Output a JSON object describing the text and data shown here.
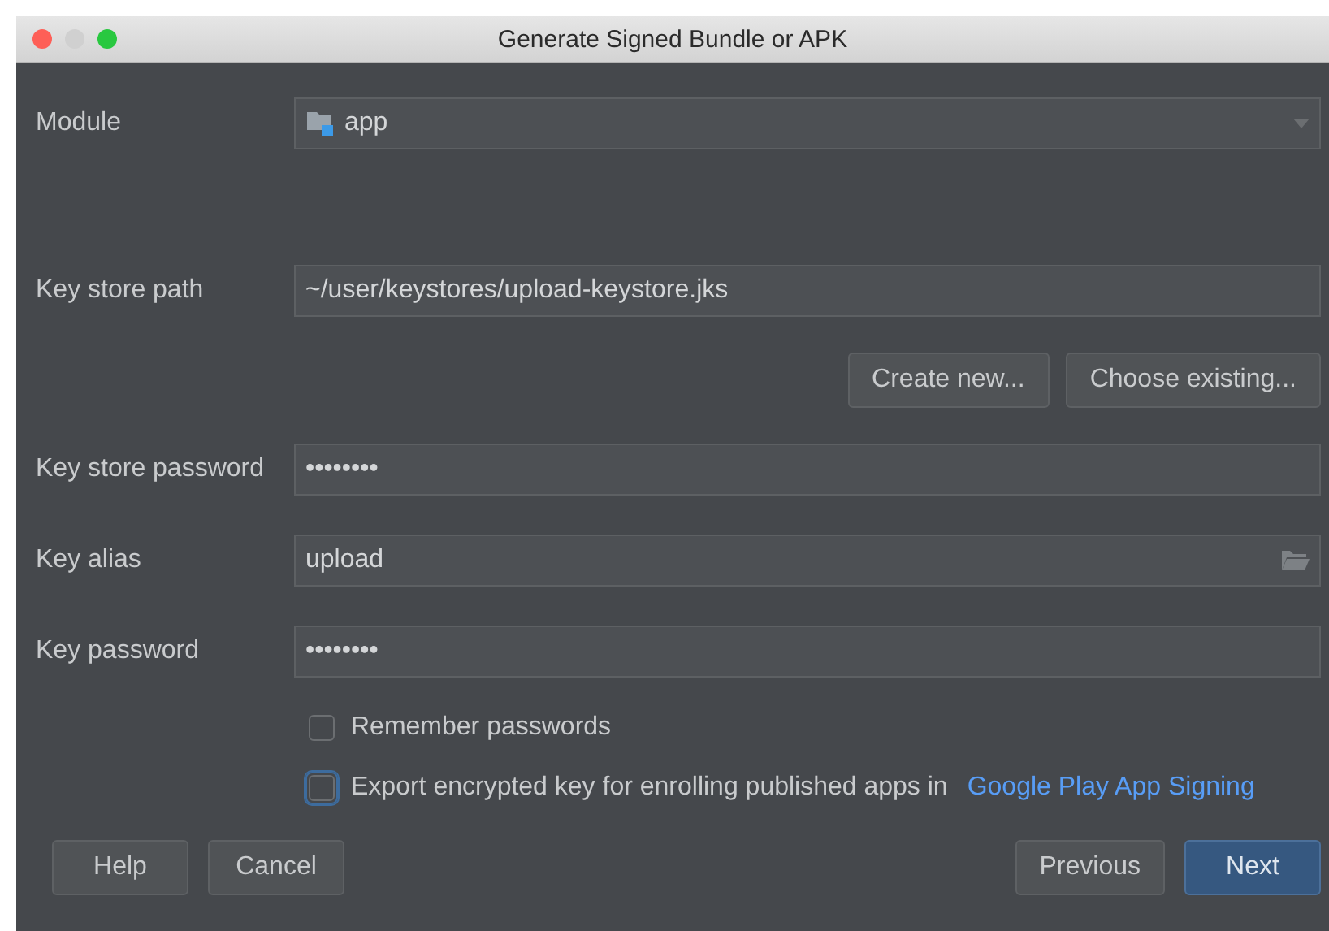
{
  "window": {
    "title": "Generate Signed Bundle or APK"
  },
  "module": {
    "label": "Module",
    "value": "app"
  },
  "key_store_path": {
    "label": "Key store path",
    "value": "~/user/keystores/upload-keystore.jks"
  },
  "key_store_buttons": [
    {
      "label": "Create new..."
    },
    {
      "label": "Choose existing..."
    }
  ],
  "key_store_password": {
    "label": "Key store password",
    "value": "••••••••"
  },
  "key_alias": {
    "label": "Key alias",
    "value": "upload"
  },
  "key_password": {
    "label": "Key password",
    "value": "••••••••"
  },
  "checkboxes": [
    {
      "label": "Remember passwords",
      "checked": false,
      "focused": false
    },
    {
      "label": "Export encrypted key for enrolling published apps in",
      "link": "Google Play App Signing",
      "checked": false,
      "focused": true
    }
  ],
  "left_buttons": [
    {
      "label": "Help",
      "primary": false
    },
    {
      "label": "Cancel",
      "primary": false
    }
  ],
  "right_buttons": [
    {
      "label": "Previous",
      "primary": false
    },
    {
      "label": "Next",
      "primary": true
    }
  ]
}
